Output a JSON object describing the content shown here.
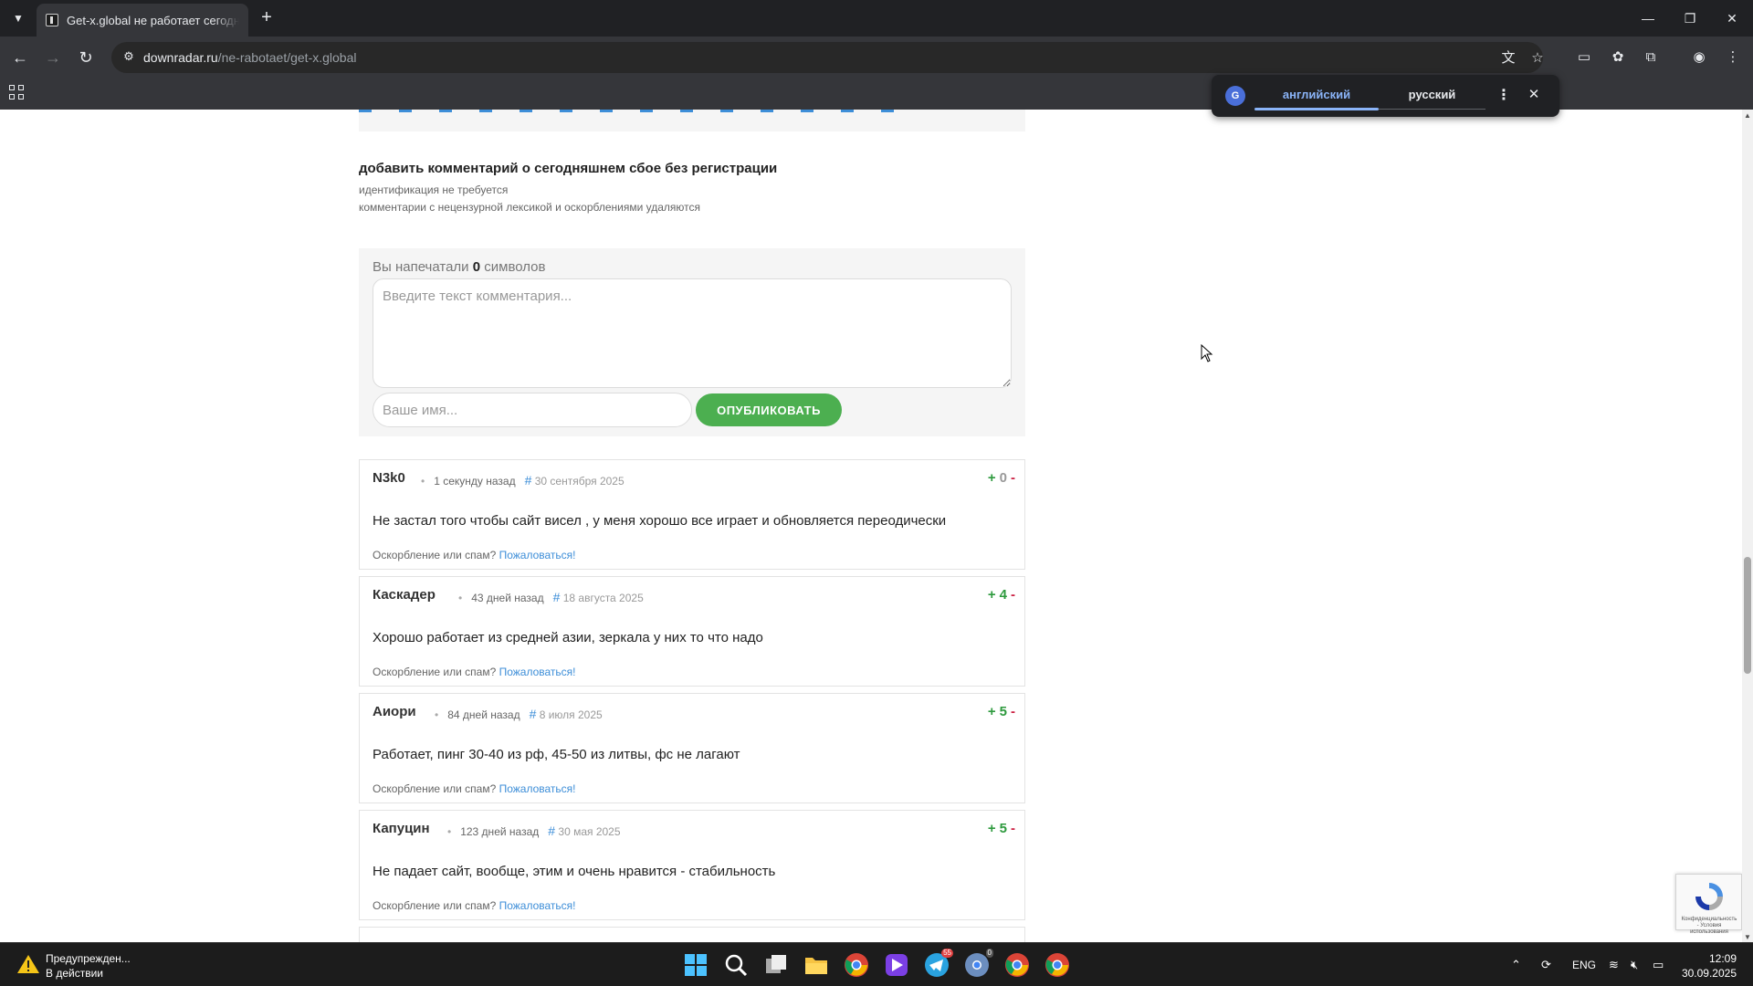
{
  "browser": {
    "tab_title": "Get-x.global не работает сегодня с",
    "url_host": "downradar.ru",
    "url_path": "/ne-rabotaet/get-x.global"
  },
  "translate_popup": {
    "source_lang": "английский",
    "target_lang": "русский"
  },
  "form": {
    "heading": "добавить комментарий о сегодняшнем сбое без регистрации",
    "note1": "идентификация не требуется",
    "note2": "комментарии с нецензурной лексикой и оскорблениями удаляются",
    "counter_prefix": "Вы напечатали",
    "counter_value": "0",
    "counter_suffix": "символов",
    "comment_placeholder": "Введите текст комментария...",
    "name_placeholder": "Ваше имя...",
    "publish_label": "ОПУБЛИКОВАТЬ"
  },
  "comments": [
    {
      "author": "N3k0",
      "ago": "1 секунду назад",
      "hash": "#",
      "date": "30 сентября 2025",
      "plus": "+",
      "score": "0",
      "minus": "-",
      "text": "Не застал того чтобы сайт висел , у меня хорошо все играет и обновляется переодически",
      "report_prefix": "Оскорбление или спам?",
      "report_link": "Пожаловаться!"
    },
    {
      "author": "Каскадер",
      "ago": "43 дней назад",
      "hash": "#",
      "date": "18 августа 2025",
      "plus": "+",
      "score": "4",
      "minus": "-",
      "text": "Хорошо работает из средней азии, зеркала у них то что надо",
      "report_prefix": "Оскорбление или спам?",
      "report_link": "Пожаловаться!"
    },
    {
      "author": "Аиори",
      "ago": "84 дней назад",
      "hash": "#",
      "date": "8 июля 2025",
      "plus": "+",
      "score": "5",
      "minus": "-",
      "text": "Работает, пинг 30-40 из рф, 45-50 из литвы, фс не лагают",
      "report_prefix": "Оскорбление или спам?",
      "report_link": "Пожаловаться!"
    },
    {
      "author": "Капуцин",
      "ago": "123 дней назад",
      "hash": "#",
      "date": "30 мая 2025",
      "plus": "+",
      "score": "5",
      "minus": "-",
      "text": "Не падает сайт, вообще, этим и очень нравится - стабильность",
      "report_prefix": "Оскорбление или спам?",
      "report_link": "Пожаловаться!"
    }
  ],
  "recaptcha": {
    "text": "Конфиденциальность - Условия использования"
  },
  "taskbar": {
    "notification_title": "Предупрежден...",
    "notification_sub": "В действии",
    "telegram_badge": "55",
    "chrome_badge": "0",
    "lang": "ENG",
    "time": "12:09",
    "date": "30.09.2025"
  },
  "colors": {
    "accent_green": "#4caf50",
    "link_blue": "#3d8ed8",
    "chrome_dark": "#202124"
  }
}
